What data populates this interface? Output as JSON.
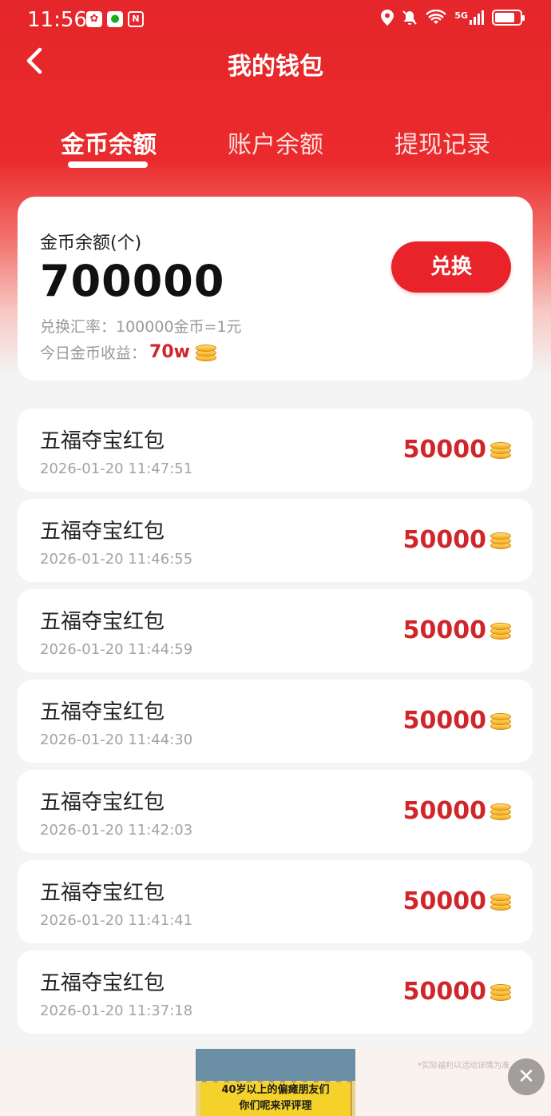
{
  "status_bar": {
    "time": "11:56",
    "app_icons": [
      "huawei-icon",
      "wechat-icon",
      "nfc-icon"
    ],
    "right_icons": [
      "location-icon",
      "mute-icon",
      "wifi-icon",
      "signal-5g-icon",
      "battery-icon"
    ],
    "network_label": "5G"
  },
  "header": {
    "title": "我的钱包",
    "back_icon": "chevron-left-icon"
  },
  "tabs": [
    {
      "label": "金币余额",
      "active": true
    },
    {
      "label": "账户余额",
      "active": false
    },
    {
      "label": "提现记录",
      "active": false
    }
  ],
  "balance": {
    "label": "金币余额(个)",
    "value": "700000",
    "exchange_rate": "兑换汇率：100000金币=1元",
    "today_label": "今日金币收益：",
    "today_value": "70w",
    "exchange_button": "兑换"
  },
  "records": [
    {
      "title": "五福夺宝红包",
      "time": "2026-01-20 11:47:51",
      "amount": "50000"
    },
    {
      "title": "五福夺宝红包",
      "time": "2026-01-20 11:46:55",
      "amount": "50000"
    },
    {
      "title": "五福夺宝红包",
      "time": "2026-01-20 11:44:59",
      "amount": "50000"
    },
    {
      "title": "五福夺宝红包",
      "time": "2026-01-20 11:44:30",
      "amount": "50000"
    },
    {
      "title": "五福夺宝红包",
      "time": "2026-01-20 11:42:03",
      "amount": "50000"
    },
    {
      "title": "五福夺宝红包",
      "time": "2026-01-20 11:41:41",
      "amount": "50000"
    },
    {
      "title": "五福夺宝红包",
      "time": "2026-01-20 11:37:18",
      "amount": "50000"
    }
  ],
  "ad": {
    "caption_line1": "40岁以上的偏瘫朋友们",
    "caption_line2": "你们呢来评评理",
    "tag": "*实际福利以活动详情为准",
    "close_icon": "close-icon"
  },
  "colors": {
    "brand_red": "#e5262a",
    "amount_red": "#d0262a",
    "coin_gold": "#f3a619"
  }
}
